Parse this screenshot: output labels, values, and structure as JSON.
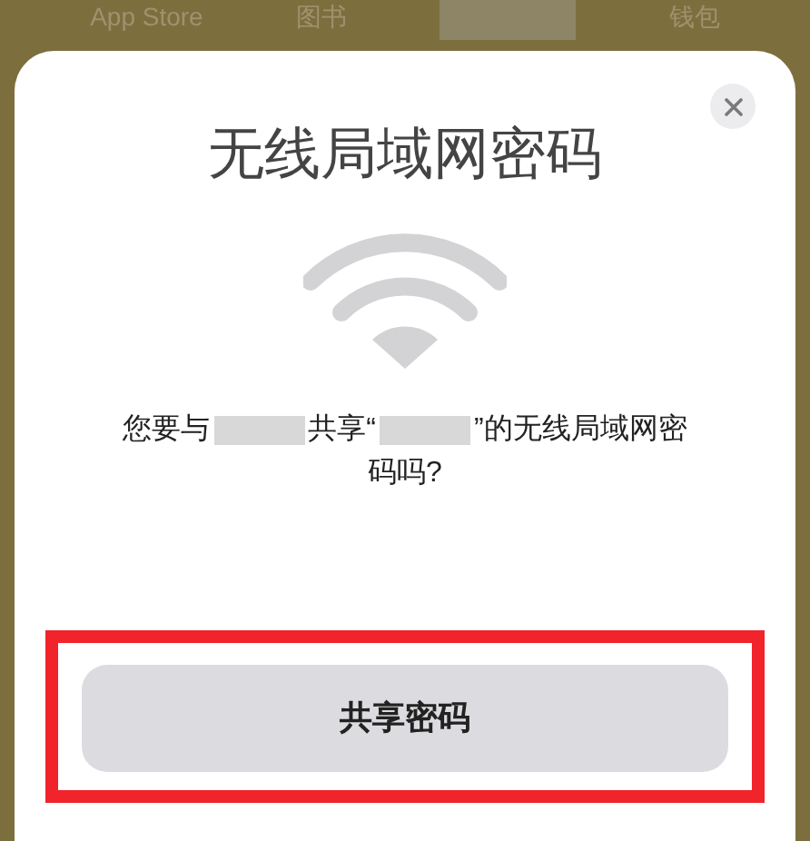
{
  "top_tabs": [
    {
      "kind": "text",
      "label": "App Store"
    },
    {
      "kind": "text",
      "label": "图书"
    },
    {
      "kind": "redacted"
    },
    {
      "kind": "text",
      "label": "钱包"
    }
  ],
  "dialog": {
    "title": "无线局域网密码",
    "message": [
      {
        "kind": "text",
        "text": "您要与"
      },
      {
        "kind": "redacted"
      },
      {
        "kind": "text",
        "text": "共享“"
      },
      {
        "kind": "redacted"
      },
      {
        "kind": "text",
        "text": "”的无线局域网密"
      },
      {
        "kind": "break"
      },
      {
        "kind": "text",
        "text": "码吗?"
      }
    ],
    "button": {
      "label": "共享密码",
      "highlighted": true
    }
  }
}
